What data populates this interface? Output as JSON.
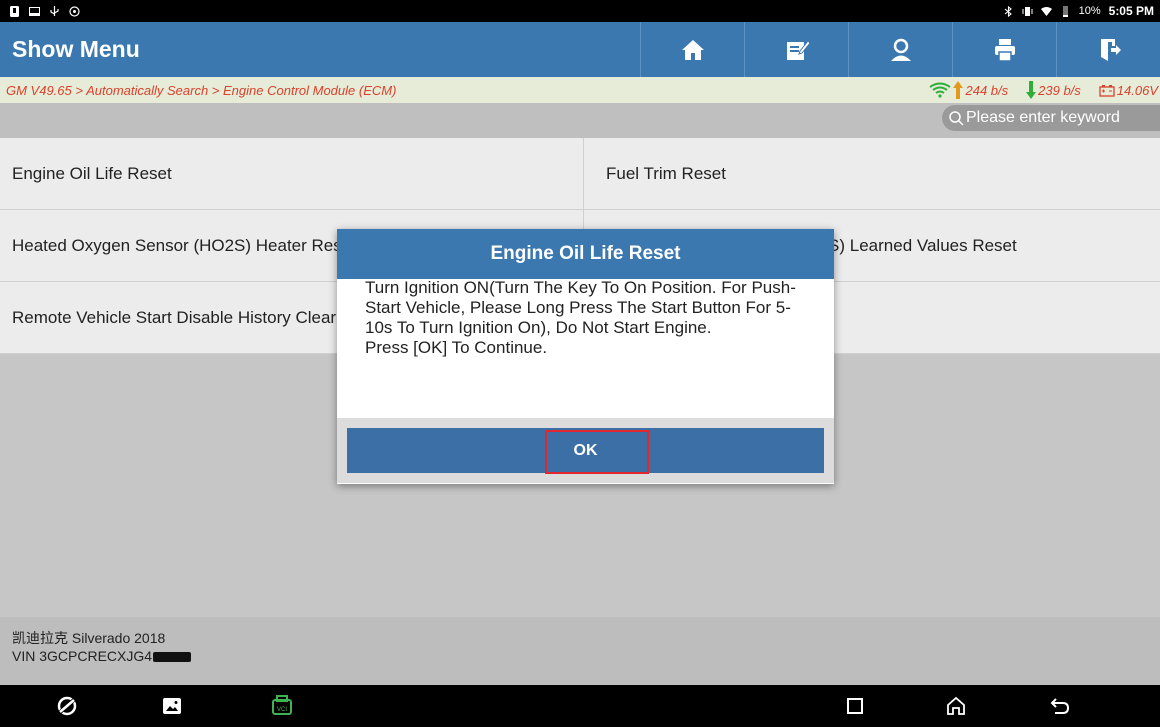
{
  "statusbar": {
    "battery_percent": "10%",
    "time": "5:05 PM"
  },
  "header": {
    "title": "Show Menu",
    "toolbar_icons": [
      "home-icon",
      "edit-icon",
      "user-icon",
      "print-icon",
      "exit-icon"
    ]
  },
  "breadcrumb": {
    "path": "GM V49.65 > Automatically Search > Engine Control Module (ECM)",
    "upload_rate": "244 b/s",
    "download_rate": "239 b/s",
    "voltage": "14.06V"
  },
  "search": {
    "placeholder": "Please enter keyword"
  },
  "menu": {
    "items": [
      {
        "label": "Engine Oil Life Reset"
      },
      {
        "label": "Fuel Trim Reset"
      },
      {
        "label": "Heated Oxygen Sensor (HO2S) Heater Resistance Learned Values Reset"
      },
      {
        "label": "Heated Oxygen Sensor (HO2S) Learned Values Reset"
      },
      {
        "label": "Remote Vehicle Start Disable History Clear"
      },
      {
        "label": ""
      }
    ]
  },
  "footer": {
    "vehicle": "凯迪拉克 Silverado 2018",
    "vin_prefix": "VIN 3GCPCRECXJG4"
  },
  "dialog": {
    "title": "Engine Oil Life Reset",
    "message_line1": "Turn Ignition ON(Turn The Key To On Position. For Push-Start Vehicle, Please Long Press The Start Button For 5-10s To Turn Ignition On), Do Not Start Engine.",
    "message_line2": "Press [OK] To Continue.",
    "ok_label": "OK"
  },
  "colors": {
    "primary": "#3b78b0",
    "breadcrumb_text": "#d9412b",
    "highlight": "#e0262f"
  }
}
